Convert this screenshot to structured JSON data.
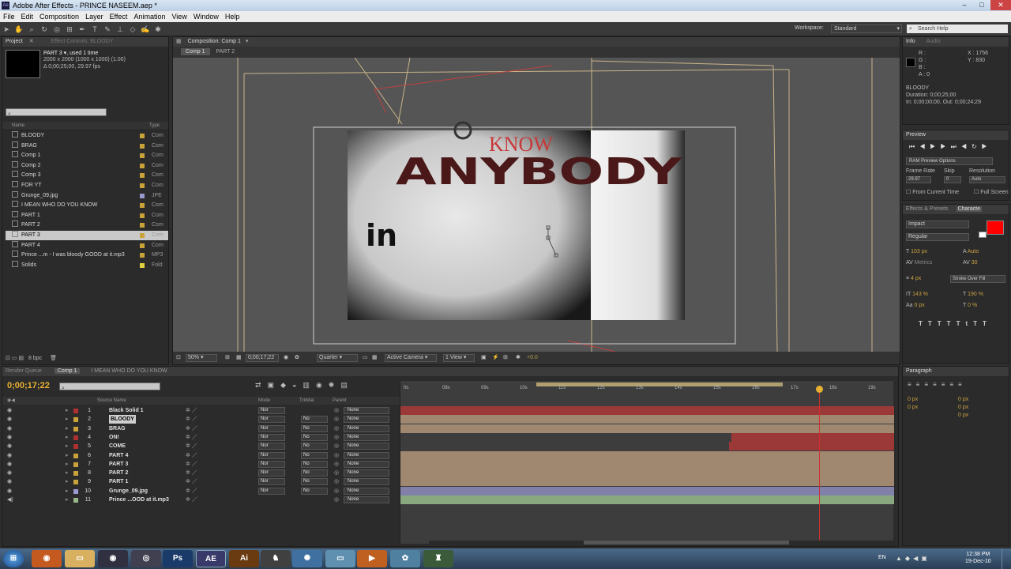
{
  "window": {
    "title": "Adobe After Effects - PRINCE NASEEM.aep *",
    "controls": [
      "–",
      "□",
      "✕"
    ]
  },
  "menu": [
    "File",
    "Edit",
    "Composition",
    "Layer",
    "Effect",
    "Animation",
    "View",
    "Window",
    "Help"
  ],
  "workspace": {
    "label": "Workspace:",
    "value": "Standard",
    "search_placeholder": "Search Help"
  },
  "project": {
    "tabs": [
      "Project",
      "Effect Controls: BLOODY"
    ],
    "selected_name": "PART 3 ▾, used 1 time",
    "selected_info": [
      "2000 x 2000  (1000 x 1000) (1.00)",
      "Δ 0;00;25;00, 29.97 fps"
    ],
    "col_name": "Name",
    "col_type": "Type",
    "items": [
      {
        "name": "BLOODY",
        "type": "Com",
        "color": "#c9a23a"
      },
      {
        "name": "BRAG",
        "type": "Com",
        "color": "#c9a23a"
      },
      {
        "name": "Comp 1",
        "type": "Com",
        "color": "#c9a23a"
      },
      {
        "name": "Comp 2",
        "type": "Com",
        "color": "#c9a23a"
      },
      {
        "name": "Comp 3",
        "type": "Com",
        "color": "#c9a23a"
      },
      {
        "name": "FOR YT",
        "type": "Com",
        "color": "#c9a23a"
      },
      {
        "name": "Grunge_09.jpg",
        "type": "JPE",
        "color": "#9a9ad0"
      },
      {
        "name": "I MEAN WHO DO YOU KNOW",
        "type": "Com",
        "color": "#c9a23a"
      },
      {
        "name": "PART 1",
        "type": "Com",
        "color": "#c9a23a"
      },
      {
        "name": "PART 2",
        "type": "Com",
        "color": "#c9a23a"
      },
      {
        "name": "PART 3",
        "type": "Com",
        "color": "#c9a23a"
      },
      {
        "name": "PART 4",
        "type": "Com",
        "color": "#c9a23a"
      },
      {
        "name": "Prince ...m - I was bloody GOOD at it.mp3",
        "type": "MP3",
        "color": "#c9a23a"
      },
      {
        "name": "Solids",
        "type": "Fold",
        "color": "#e0d040"
      }
    ],
    "bpc": "8 bpc"
  },
  "composition": {
    "tab": "Composition: Comp 1",
    "subtabs": [
      "Comp 1",
      "PART 2"
    ],
    "text_top": "KNOW",
    "text_main": "ANYBODY",
    "text_small": "in",
    "zoom": "50%",
    "timecode": "0;00;17;22",
    "quality": "Quarter",
    "camera": "Active Camera",
    "view": "1 View",
    "exposure": "+0.0"
  },
  "info": {
    "tabs": [
      "Info",
      "Audio"
    ],
    "rgba": [
      "R :",
      "G :",
      "B :",
      "A : 0"
    ],
    "xy": [
      "X : 1756",
      "Y : 830"
    ],
    "layer": "BLOODY",
    "duration": "Duration: 0;00;25;00",
    "inout": "In: 0;00;00;00, Out: 0;00;24;29"
  },
  "preview": {
    "tab": "Preview",
    "ram": "RAM Preview Options",
    "frame_rate_label": "Frame Rate",
    "skip_label": "Skip",
    "resolution_label": "Resolution",
    "frame_rate": "29.97",
    "skip": "0",
    "resolution": "Auto",
    "from_current": "From Current Time",
    "full_screen": "Full Screen"
  },
  "character": {
    "tabs": [
      "Effects & Presets",
      "Characte"
    ],
    "font": "Impact",
    "style": "Regular",
    "size": "103 px",
    "leading": "Auto",
    "kerning": "Metrics",
    "tracking": "30",
    "stroke": "4 px",
    "stroke_type": "Stroke Over Fill",
    "vscale": "143 %",
    "hscale": "190 %",
    "baseline": "0 px",
    "tsume": "0 %",
    "fill_color": "#ff0000"
  },
  "paragraph": {
    "tab": "Paragraph",
    "values": [
      "0 px",
      "0 px",
      "0 px",
      "0 px",
      "0 px"
    ]
  },
  "timeline": {
    "tabs": [
      "Render Queue",
      "Comp 1",
      "I MEAN WHO DO YOU KNOW"
    ],
    "timecode": "0;00;17;22",
    "search_placeholder": "",
    "col_source": "Source Name",
    "col_mode": "Mode",
    "col_trk": "TrkMat",
    "col_parent": "Parent",
    "ruler": [
      "0s",
      "08s",
      "09s",
      "10s",
      "11s",
      "12s",
      "13s",
      "14s",
      "15s",
      "16s",
      "17s",
      "18s",
      "19s"
    ],
    "layers": [
      {
        "num": "1",
        "name": "Black Solid 1",
        "mode": "Nor",
        "trk": "",
        "parent": "None",
        "color": "#b03030",
        "bar": "#9b3838",
        "start": 0
      },
      {
        "num": "2",
        "name": "BLOODY",
        "mode": "Nor",
        "trk": "No",
        "parent": "None",
        "color": "#c9a23a",
        "bar": "#a08870",
        "start": 0
      },
      {
        "num": "3",
        "name": "BRAG",
        "mode": "Nor",
        "trk": "No",
        "parent": "None",
        "color": "#c9a23a",
        "bar": "#a08870",
        "start": 0
      },
      {
        "num": "4",
        "name": "ON!",
        "mode": "Nor",
        "trk": "No",
        "parent": "None",
        "color": "#b03030",
        "bar": "#9b3838",
        "start": 0.67
      },
      {
        "num": "5",
        "name": "COME",
        "mode": "Nor",
        "trk": "No",
        "parent": "None",
        "color": "#b03030",
        "bar": "#9b3838",
        "start": 0.665
      },
      {
        "num": "6",
        "name": "PART 4",
        "mode": "Nor",
        "trk": "No",
        "parent": "None",
        "color": "#c9a23a",
        "bar": "#a08870",
        "start": 0
      },
      {
        "num": "7",
        "name": "PART 3",
        "mode": "Nor",
        "trk": "No",
        "parent": "None",
        "color": "#c9a23a",
        "bar": "#a08870",
        "start": 0
      },
      {
        "num": "8",
        "name": "PART 2",
        "mode": "Nor",
        "trk": "No",
        "parent": "None",
        "color": "#c9a23a",
        "bar": "#a08870",
        "start": 0
      },
      {
        "num": "9",
        "name": "PART 1",
        "mode": "Nor",
        "trk": "No",
        "parent": "None",
        "color": "#c9a23a",
        "bar": "#a08870",
        "start": 0
      },
      {
        "num": "10",
        "name": "Grunge_09.jpg",
        "mode": "Nor",
        "trk": "No",
        "parent": "None",
        "color": "#9a9ad0",
        "bar": "#8080a8",
        "start": 0
      },
      {
        "num": "11",
        "name": "Prince ...OOD at it.mp3",
        "mode": "",
        "trk": "",
        "parent": "None",
        "color": "#9ab88a",
        "bar": "#8aa880",
        "start": 0
      }
    ]
  },
  "taskbar": {
    "apps": [
      "Ps",
      "AE",
      "Ai"
    ],
    "lang": "EN",
    "time": "12:38 PM",
    "date": "19-Dec-10"
  }
}
